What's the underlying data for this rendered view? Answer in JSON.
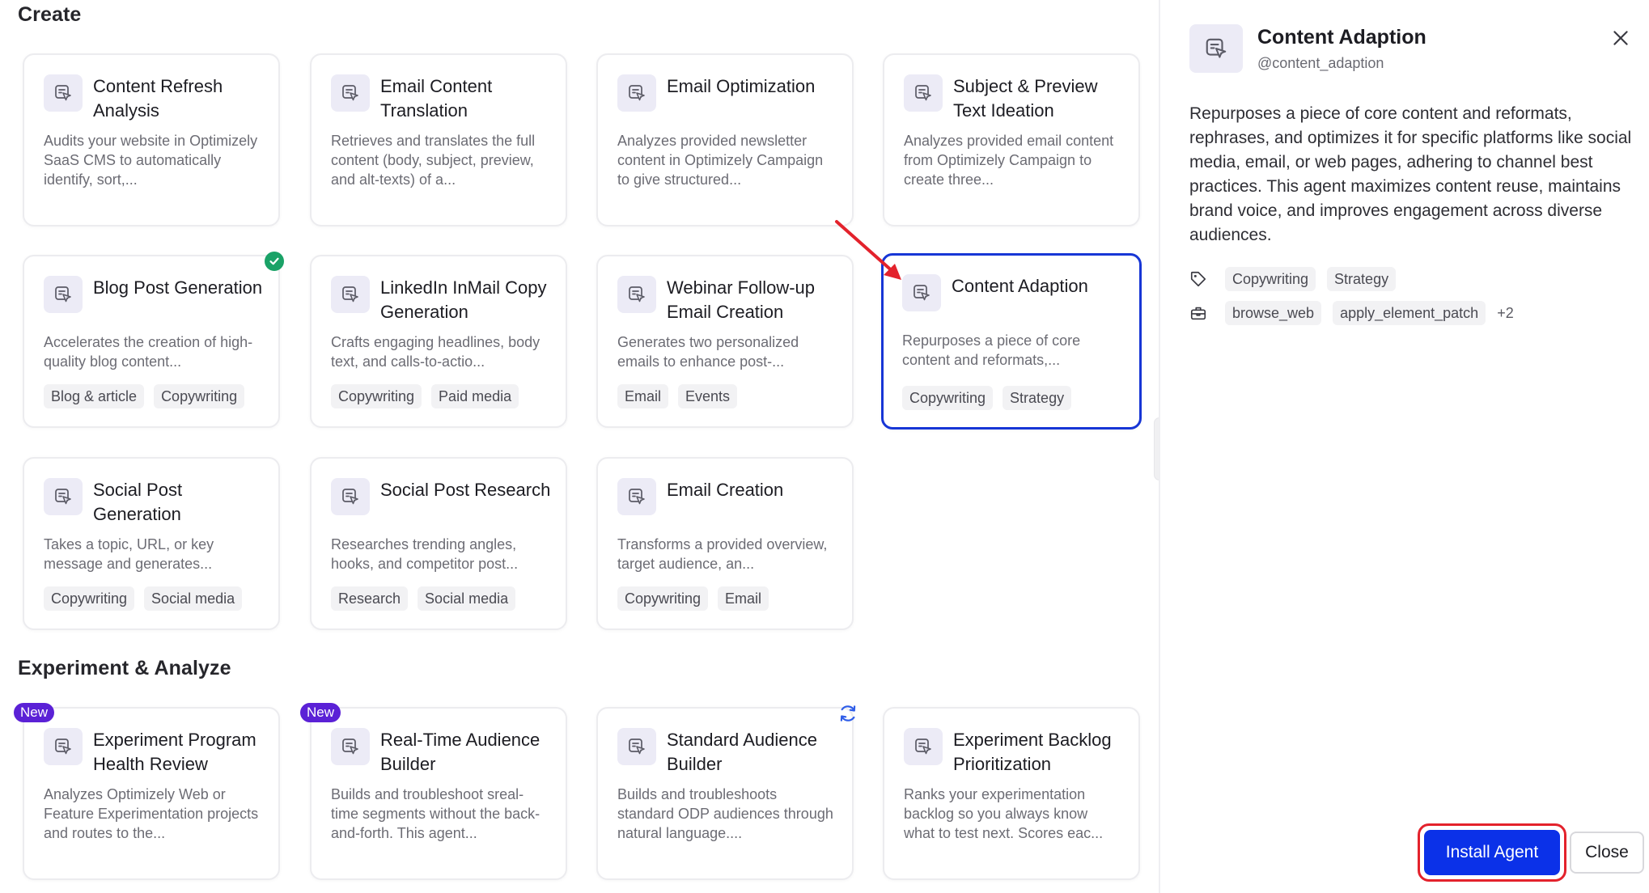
{
  "sections": {
    "create_title": "Create",
    "experiment_title": "Experiment & Analyze"
  },
  "cards": {
    "content_refresh": {
      "title": "Content Refresh Analysis",
      "desc": "Audits your website in Optimizely SaaS CMS to automatically identify, sort,..."
    },
    "email_translation": {
      "title": "Email Content Translation",
      "desc": "Retrieves and translates the full content (body, subject, preview, and alt-texts) of a..."
    },
    "email_optimization": {
      "title": "Email Optimization",
      "desc": "Analyzes provided newsletter content in Optimizely Campaign to give structured..."
    },
    "subject_preview": {
      "title": "Subject & Preview Text Ideation",
      "desc": "Analyzes provided email content from Optimizely Campaign to create three..."
    },
    "blog_post": {
      "title": "Blog Post Generation",
      "desc": "Accelerates the creation of high-quality blog content...",
      "tags": [
        "Blog & article",
        "Copywriting"
      ]
    },
    "linkedin": {
      "title": "LinkedIn InMail Copy Generation",
      "desc": "Crafts engaging headlines, body text, and calls-to-actio...",
      "tags": [
        "Copywriting",
        "Paid media"
      ]
    },
    "webinar": {
      "title": "Webinar Follow-up Email Creation",
      "desc": "Generates two personalized emails to enhance post-...",
      "tags": [
        "Email",
        "Events"
      ]
    },
    "content_adaption": {
      "title": "Content Adaption",
      "desc": "Repurposes a piece of core content and reformats,...",
      "tags": [
        "Copywriting",
        "Strategy"
      ]
    },
    "social_gen": {
      "title": "Social Post Generation",
      "desc": "Takes a topic, URL, or key message and generates...",
      "tags": [
        "Copywriting",
        "Social media"
      ]
    },
    "social_research": {
      "title": "Social Post Research",
      "desc": "Researches trending angles, hooks, and competitor post...",
      "tags": [
        "Research",
        "Social media"
      ]
    },
    "email_creation": {
      "title": "Email Creation",
      "desc": "Transforms a provided overview, target audience, an...",
      "tags": [
        "Copywriting",
        "Email"
      ]
    },
    "exp_health": {
      "title": "Experiment Program Health Review",
      "desc": "Analyzes Optimizely Web or Feature Experimentation projects and routes to the...",
      "badge": "New"
    },
    "realtime_audience": {
      "title": "Real-Time Audience Builder",
      "desc": "Builds and troubleshoot sreal-time segments without the back-and-forth. This agent...",
      "badge": "New"
    },
    "standard_audience": {
      "title": "Standard Audience Builder",
      "desc": "Builds and troubleshoots standard ODP audiences through natural language...."
    },
    "exp_backlog": {
      "title": "Experiment Backlog Prioritization",
      "desc": "Ranks your experimentation backlog so you always know what to test next. Scores eac..."
    }
  },
  "panel": {
    "title": "Content Adaption",
    "handle": "@content_adaption",
    "description": "Repurposes a piece of core content and reformats, rephrases, and optimizes it for specific platforms like social media, email, or web pages, adhering to channel best practices. This agent maximizes content reuse, maintains brand voice, and improves engagement across diverse audiences.",
    "tags": [
      "Copywriting",
      "Strategy"
    ],
    "tools": [
      "browse_web",
      "apply_element_patch"
    ],
    "tools_more": "+2",
    "install_label": "Install Agent",
    "close_label": "Close"
  },
  "colors": {
    "accent": "#0b31e8",
    "selected_border": "#1736d6",
    "new_badge": "#5b21d6",
    "check_green": "#1aa267",
    "annotation_red": "#e3222c"
  }
}
